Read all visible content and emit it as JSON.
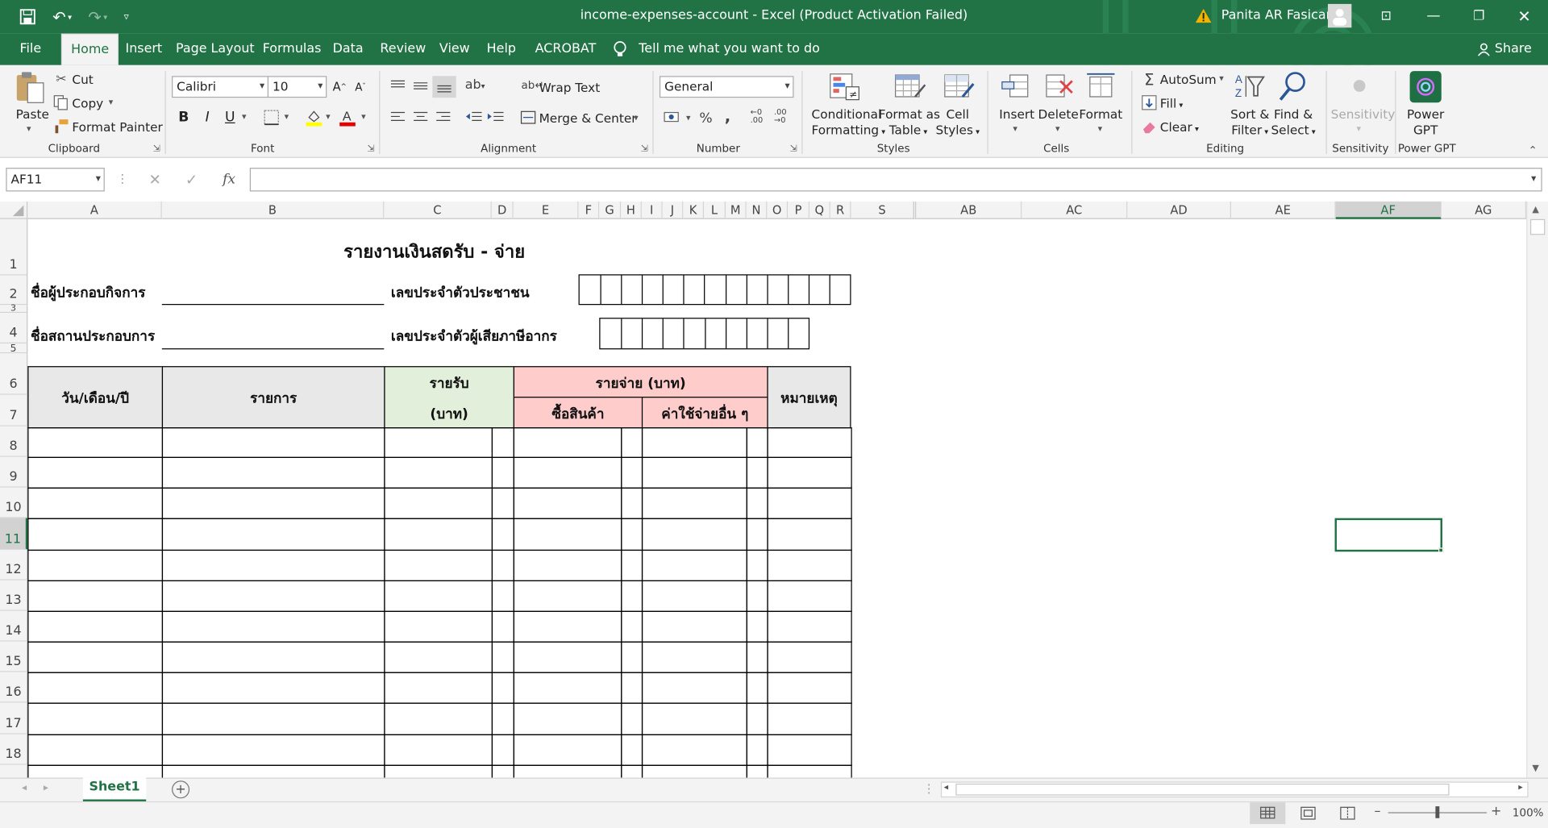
{
  "window": {
    "title": "income-expenses-account  -  Excel (Product Activation Failed)",
    "user": "Panita AR Fasicare",
    "share": "Share"
  },
  "tabs": [
    "File",
    "Home",
    "Insert",
    "Page Layout",
    "Formulas",
    "Data",
    "Review",
    "View",
    "Help",
    "ACROBAT"
  ],
  "tell_me": "Tell me what you want to do",
  "ribbon": {
    "clipboard": {
      "paste": "Paste",
      "cut": "Cut",
      "copy": "Copy",
      "format_painter": "Format Painter",
      "label": "Clipboard"
    },
    "font": {
      "name": "Calibri",
      "size": "10",
      "bold": "B",
      "italic": "I",
      "underline": "U",
      "label": "Font"
    },
    "alignment": {
      "wrap": "Wrap Text",
      "merge": "Merge & Center",
      "label": "Alignment"
    },
    "number": {
      "format": "General",
      "percent": "%",
      "comma": ",",
      "label": "Number"
    },
    "styles": {
      "conditional_1": "Conditional",
      "conditional_2": "Formatting",
      "table_1": "Format as",
      "table_2": "Table",
      "cell_1": "Cell",
      "cell_2": "Styles",
      "label": "Styles"
    },
    "cells": {
      "insert": "Insert",
      "delete": "Delete",
      "format": "Format",
      "label": "Cells"
    },
    "editing": {
      "autosum": "AutoSum",
      "fill": "Fill",
      "clear": "Clear",
      "sort_1": "Sort &",
      "sort_2": "Filter",
      "find_1": "Find &",
      "find_2": "Select",
      "label": "Editing"
    },
    "sensitivity": {
      "name": "Sensitivity",
      "label": "Sensitivity"
    },
    "powergpt": {
      "name_1": "Power",
      "name_2": "GPT",
      "label": "Power GPT"
    }
  },
  "formula_bar": {
    "name_box": "AF11",
    "fx": "fx",
    "formula": ""
  },
  "columns": [
    "A",
    "B",
    "C",
    "D",
    "E",
    "F",
    "G",
    "H",
    "I",
    "J",
    "K",
    "L",
    "M",
    "N",
    "O",
    "P",
    "Q",
    "R",
    "S",
    "AB",
    "AC",
    "AD",
    "AE",
    "AF",
    "AG"
  ],
  "rows": [
    "1",
    "2",
    "3",
    "4",
    "5",
    "6",
    "7",
    "8",
    "9",
    "10",
    "11",
    "12",
    "13",
    "14",
    "15",
    "16",
    "17",
    "18"
  ],
  "sheet": {
    "title": "รายงานเงินสดรับ - จ่าย",
    "business_name": "ชื่อผู้ประกอบกิจการ",
    "id_card": "เลขประจำตัวประชาชน",
    "place_name": "ชื่อสถานประกอบการ",
    "tax_id": "เลขประจำตัวผู้เสียภาษีอากร",
    "h_date": "วัน/เดือน/ปี",
    "h_item": "รายการ",
    "h_income_1": "รายรับ",
    "h_income_2": "(บาท)",
    "h_expense": "รายจ่าย (บาท)",
    "h_purchase": "ซื้อสินค้า",
    "h_other": "ค่าใช้จ่ายอื่น ๆ",
    "h_note": "หมายเหตุ"
  },
  "sheet_tab": "Sheet1",
  "zoom": "100%",
  "colors": {
    "excel_green": "#217346",
    "income_header": "#e2efda",
    "expense_header": "#ffcccc",
    "grey_header": "#e8e8e8"
  }
}
